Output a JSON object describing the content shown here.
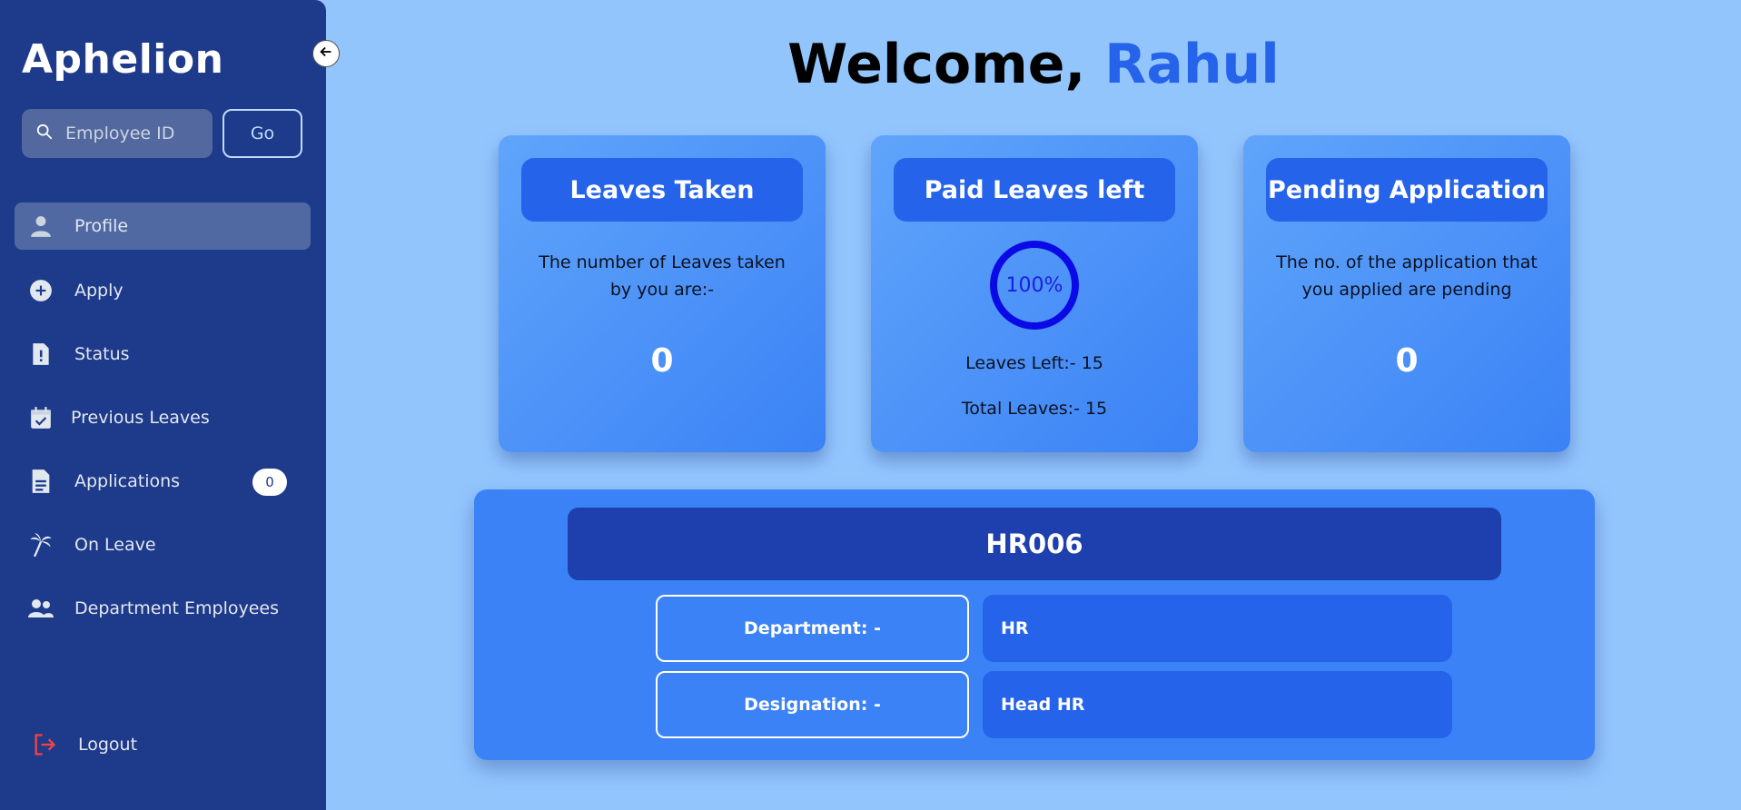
{
  "sidebar": {
    "brand": "Aphelion",
    "search": {
      "placeholder": "Employee ID",
      "value": ""
    },
    "go_label": "Go",
    "items": [
      {
        "label": "Profile",
        "icon": "person-icon",
        "active": true
      },
      {
        "label": "Apply",
        "icon": "plus-circle-icon"
      },
      {
        "label": "Status",
        "icon": "file-alert-icon"
      },
      {
        "label": "Previous Leaves",
        "icon": "calendar-check-icon"
      },
      {
        "label": "Applications",
        "icon": "document-icon",
        "badge": "0"
      },
      {
        "label": "On Leave",
        "icon": "palm-tree-icon"
      },
      {
        "label": "Department Employees",
        "icon": "people-icon"
      }
    ],
    "logout_label": "Logout"
  },
  "header": {
    "greeting": "Welcome, ",
    "name": "Rahul"
  },
  "cards": {
    "leaves_taken": {
      "title": "Leaves Taken",
      "text": "The number of Leaves taken by you are:-",
      "count": "0"
    },
    "paid_leaves": {
      "title": "Paid Leaves left",
      "percent_label": "100%",
      "percent": 100,
      "leaves_left": "Leaves Left:- 15",
      "total_leaves": "Total Leaves:- 15"
    },
    "pending": {
      "title": "Pending Application",
      "text": "The no. of the application that you applied are pending",
      "count": "0"
    }
  },
  "profile": {
    "employee_id": "HR006",
    "department_label": "Department: -",
    "department_value": "HR",
    "designation_label": "Designation: -",
    "designation_value": "Head HR"
  },
  "colors": {
    "sidebar_bg": "#1e3a8a",
    "page_bg": "#93c5fd",
    "accent": "#2563eb",
    "ring": "#0a0ae6",
    "logout_icon": "#ef4444"
  }
}
